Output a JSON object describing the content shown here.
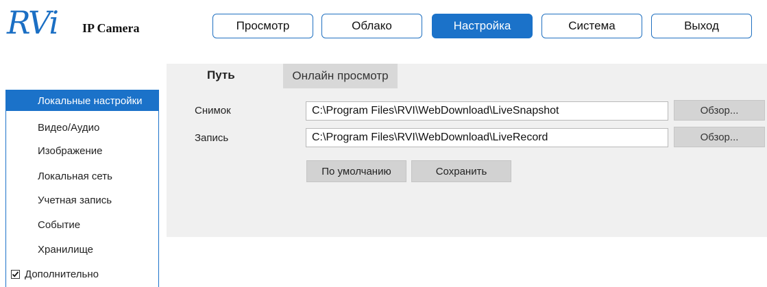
{
  "logo": {
    "brand": "RVi",
    "subtitle": "IP Camera",
    "brand_color": "#1b6fc4"
  },
  "nav": {
    "items": [
      {
        "label": "Просмотр"
      },
      {
        "label": "Облако"
      },
      {
        "label": "Настройка",
        "active": true
      },
      {
        "label": "Система"
      },
      {
        "label": "Выход"
      }
    ],
    "accent_color": "#1b72c9"
  },
  "sidebar": {
    "items": [
      {
        "label": "Локальные настройки",
        "active": true
      },
      {
        "label": "Видео/Аудио"
      },
      {
        "label": "Изображение"
      },
      {
        "label": "Локальная сеть"
      },
      {
        "label": "Учетная запись"
      },
      {
        "label": "Событие"
      },
      {
        "label": "Хранилище"
      },
      {
        "label": "Дополнительно",
        "checkbox": true,
        "checked": true
      }
    ]
  },
  "tabs": {
    "path": "Путь",
    "live": "Онлайн просмотр"
  },
  "form": {
    "snapshot": {
      "label": "Снимок",
      "value": "C:\\Program Files\\RVI\\WebDownload\\LiveSnapshot",
      "browse": "Обзор..."
    },
    "record": {
      "label": "Запись",
      "value": "C:\\Program Files\\RVI\\WebDownload\\LiveRecord",
      "browse": "Обзор..."
    },
    "default_label": "По умолчанию",
    "save_label": "Сохранить"
  }
}
